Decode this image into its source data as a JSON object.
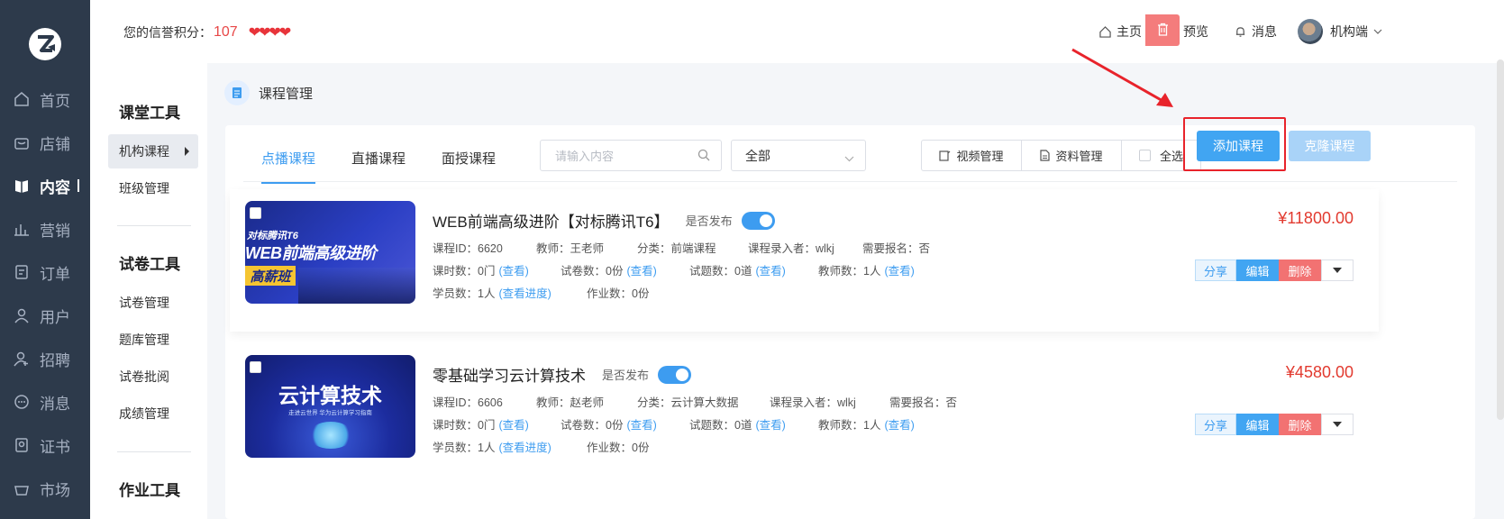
{
  "leftnav": {
    "items": [
      {
        "label": "首页",
        "icon": "home-icon"
      },
      {
        "label": "店铺",
        "icon": "store-icon"
      },
      {
        "label": "内容",
        "icon": "book-icon"
      },
      {
        "label": "营销",
        "icon": "chart-icon"
      },
      {
        "label": "订单",
        "icon": "order-icon"
      },
      {
        "label": "用户",
        "icon": "user-icon"
      },
      {
        "label": "招聘",
        "icon": "recruit-icon"
      },
      {
        "label": "消息",
        "icon": "message-icon"
      },
      {
        "label": "证书",
        "icon": "certificate-icon"
      },
      {
        "label": "市场",
        "icon": "market-icon"
      }
    ]
  },
  "topbar": {
    "credit_label": "您的信誉积分：",
    "credit_score": "107",
    "hearts": "❤❤❤❤",
    "home": "主页",
    "preview": "预览",
    "messages": "消息",
    "account": "机构端"
  },
  "subside": {
    "classroom_heading": "课堂工具",
    "org_course": "机构课程",
    "class_manage": "班级管理",
    "paper_heading": "试卷工具",
    "paper_manage": "试卷管理",
    "bank_manage": "题库管理",
    "paper_review": "试卷批阅",
    "score_manage": "成绩管理",
    "homework_heading": "作业工具"
  },
  "crumb": "课程管理",
  "tabs": [
    "点播课程",
    "直播课程",
    "面授课程"
  ],
  "search": {
    "placeholder": "请输入内容"
  },
  "filter": {
    "selected": "全部"
  },
  "toolbar": {
    "video_manage": "视频管理",
    "material_manage": "资料管理",
    "select_all": "全选",
    "add_course": "添加课程",
    "clone_course": "克隆课程"
  },
  "courses": [
    {
      "thumb_line1": "对标腾讯T6",
      "thumb_line2": "WEB前端高级进阶",
      "thumb_line3": "高薪班",
      "title": "WEB前端高级进阶【对标腾讯T6】",
      "published_label": "是否发布",
      "id": "课程ID：6620",
      "teacher": "教师：王老师",
      "category": "分类：前端课程",
      "recorder": "课程录入者：wlkj",
      "signup": "需要报名：否",
      "lessons": "课时数：0门",
      "papers": "试卷数：0份",
      "questions": "试题数：0道",
      "teachers": "教师数：1人",
      "students": "学员数：1人",
      "homework": "作业数：0份",
      "view": "(查看)",
      "view_progress": "(查看进度)",
      "price": "¥11800.00"
    },
    {
      "thumb_line1": "云计算技术",
      "thumb_line2": "走进云世界 华为云计算学习指南",
      "thumb_line3": "",
      "title": "零基础学习云计算技术",
      "published_label": "是否发布",
      "id": "课程ID：6606",
      "teacher": "教师：赵老师",
      "category": "分类：云计算大数据",
      "recorder": "课程录入者：wlkj",
      "signup": "需要报名：否",
      "lessons": "课时数：0门",
      "papers": "试卷数：0份",
      "questions": "试题数：0道",
      "teachers": "教师数：1人",
      "students": "学员数：1人",
      "homework": "作业数：0份",
      "view": "(查看)",
      "view_progress": "(查看进度)",
      "price": "¥4580.00"
    }
  ],
  "card_actions": {
    "share": "分享",
    "edit": "编辑",
    "delete": "删除"
  },
  "colors": {
    "accent": "#41a5f2",
    "danger": "#f27272",
    "price": "#e23a2f",
    "nav_bg": "#2d3a4b"
  }
}
